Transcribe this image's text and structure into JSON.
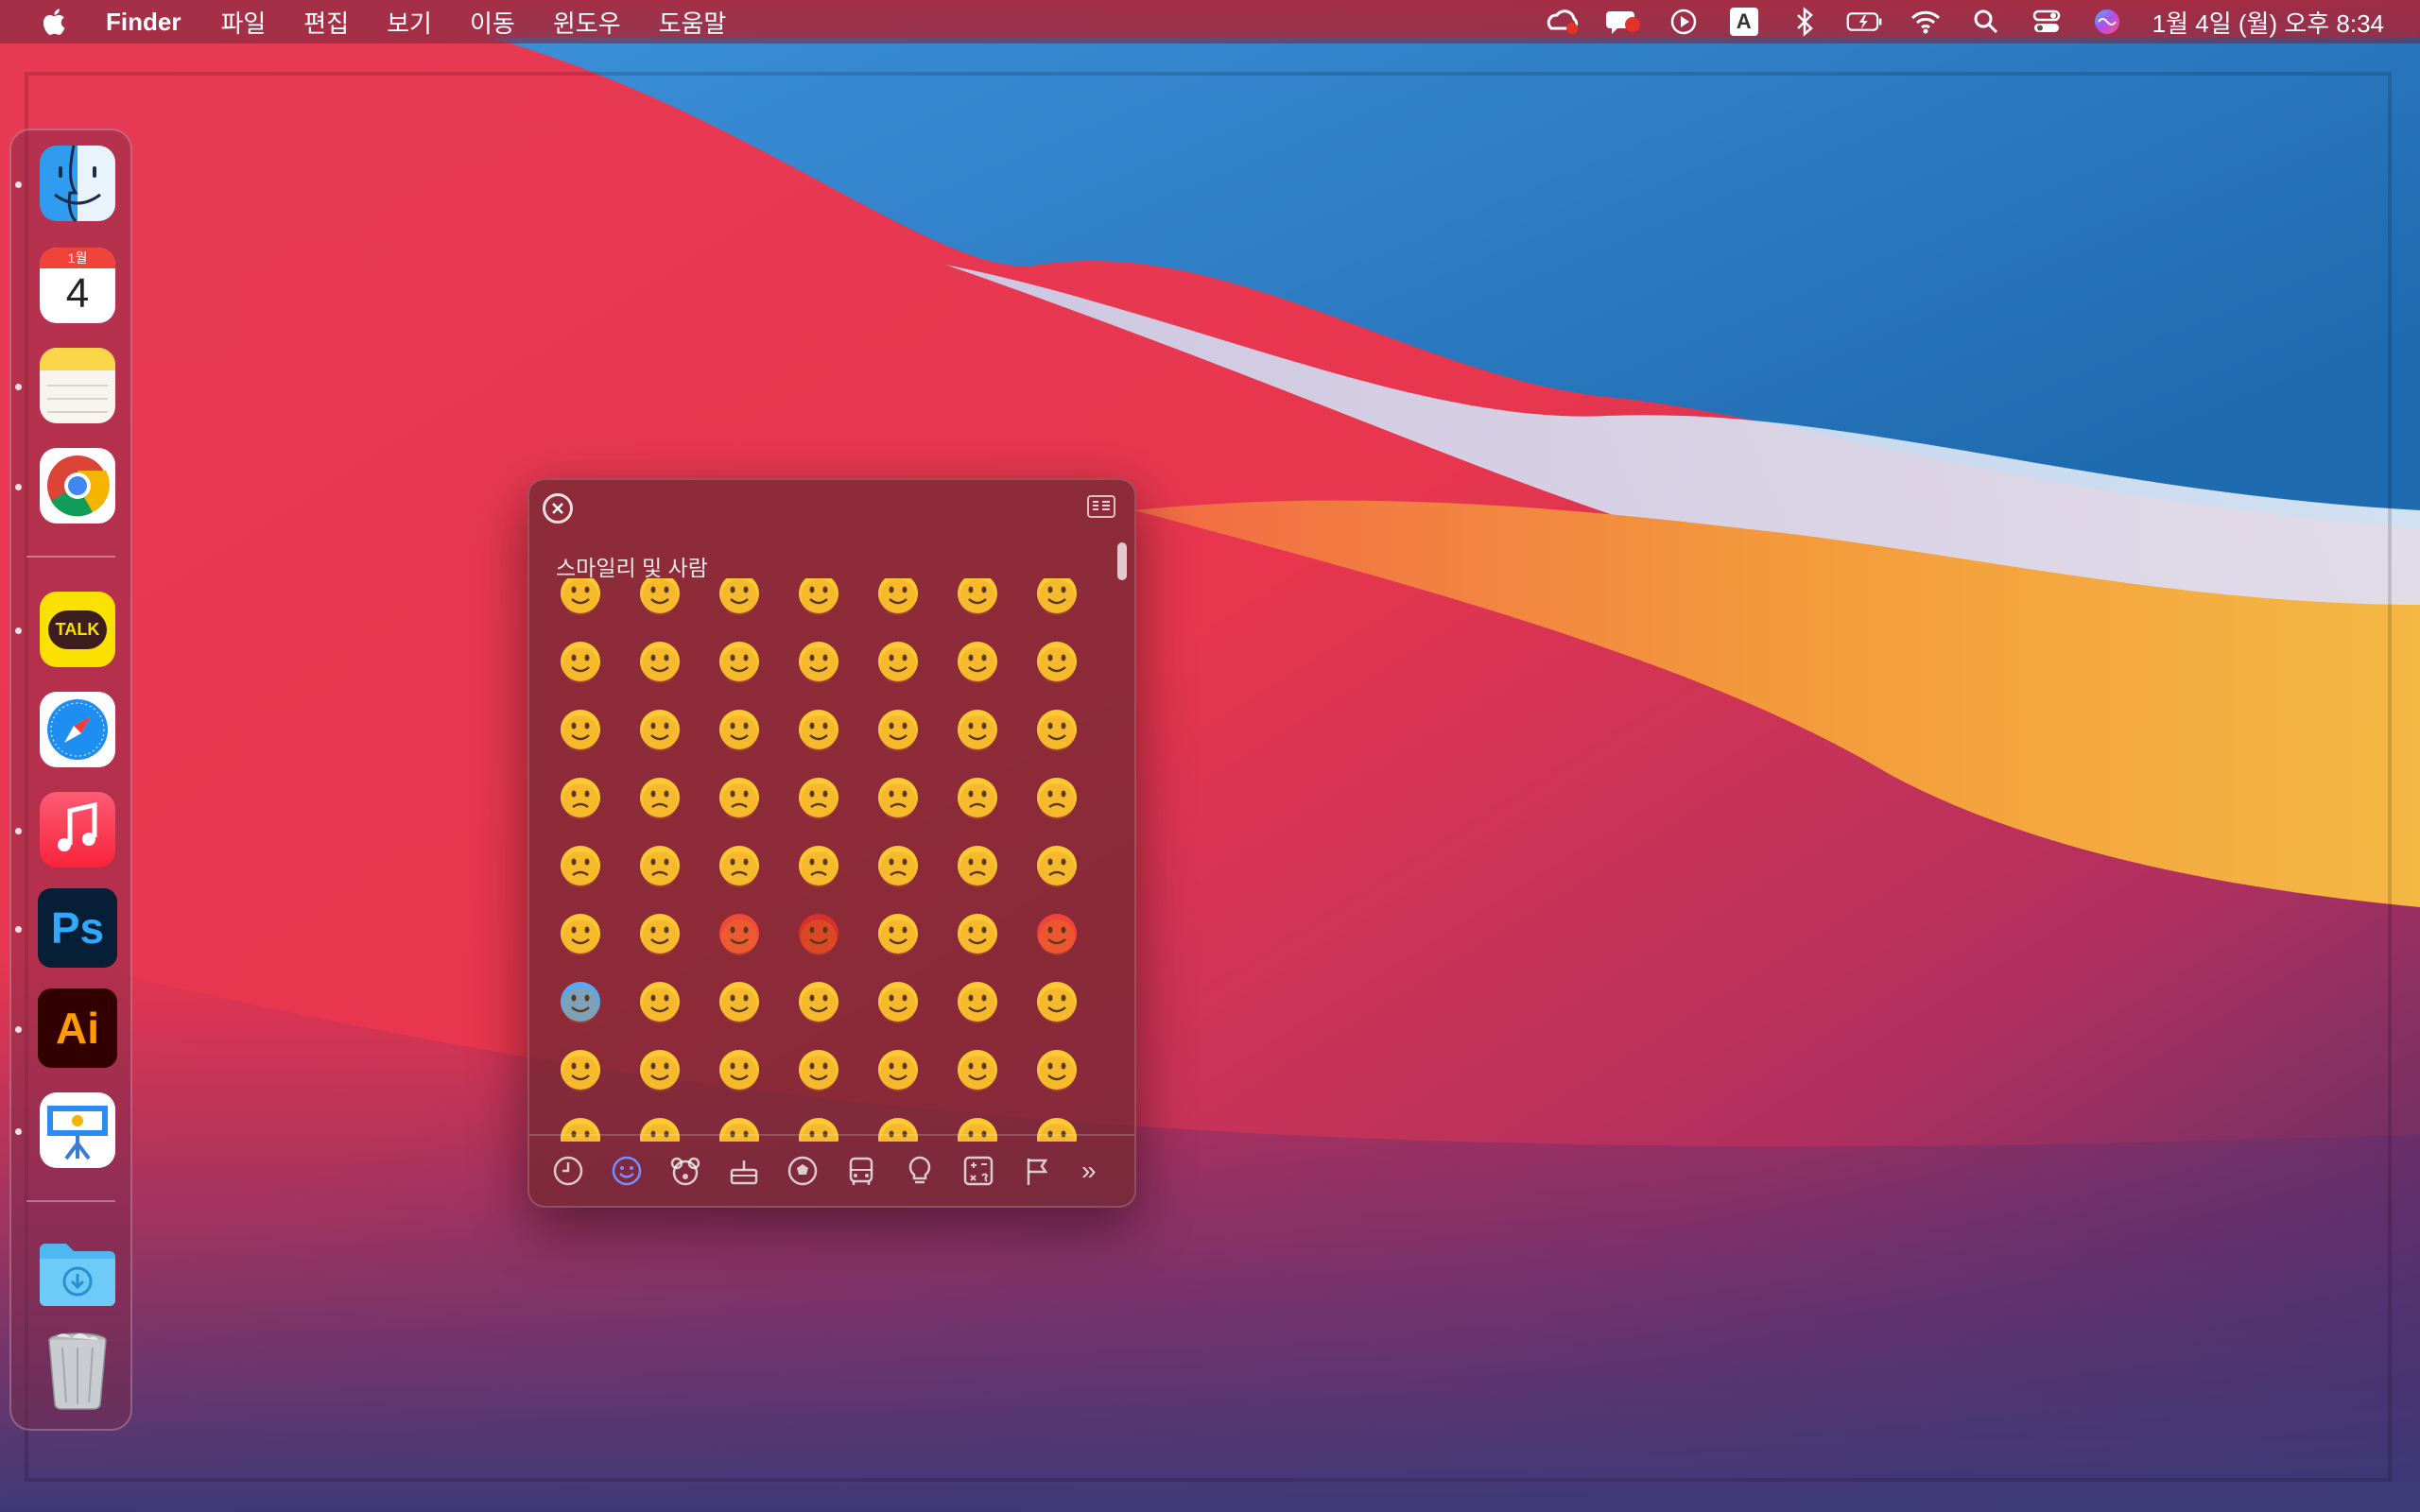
{
  "menubar": {
    "apple_icon": "apple-logo-icon",
    "app_name": "Finder",
    "menus": [
      "파일",
      "편집",
      "보기",
      "이동",
      "윈도우",
      "도움말"
    ],
    "status_icons": [
      "creative-cloud-icon",
      "notification-badge-icon",
      "play-icon",
      "input-source-A-icon",
      "bluetooth-icon",
      "battery-charging-icon",
      "wifi-icon",
      "spotlight-search-icon",
      "control-center-icon",
      "siri-icon"
    ],
    "input_source_label": "A",
    "clock": "1월 4일 (월) 오후 8:34"
  },
  "dock": {
    "items": [
      {
        "name": "finder",
        "icon": "finder-icon"
      },
      {
        "name": "calendar",
        "icon": "calendar-icon",
        "month": "1월",
        "day": "4"
      },
      {
        "name": "notes",
        "icon": "notes-icon"
      },
      {
        "name": "chrome",
        "icon": "chrome-icon"
      },
      {
        "name": "kakaotalk",
        "icon": "kakaotalk-icon",
        "label": "TALK"
      },
      {
        "name": "safari",
        "icon": "safari-icon"
      },
      {
        "name": "music",
        "icon": "music-icon"
      },
      {
        "name": "photoshop",
        "icon": "photoshop-icon",
        "label": "Ps"
      },
      {
        "name": "illustrator",
        "icon": "illustrator-icon",
        "label": "Ai"
      },
      {
        "name": "keynote",
        "icon": "keynote-icon"
      },
      {
        "name": "downloads",
        "icon": "downloads-folder-icon"
      },
      {
        "name": "trash",
        "icon": "trash-icon"
      }
    ]
  },
  "emoji_picker": {
    "section_title": "스마일리 및 사람",
    "rows": [
      [
        "😉",
        "😌",
        "😍",
        "🥰",
        "😘",
        "😗",
        "😙"
      ],
      [
        "😚",
        "😋",
        "😛",
        "😝",
        "😜",
        "🤪",
        "🤨"
      ],
      [
        "🧐",
        "🤓",
        "😎",
        "🥸",
        "🤩",
        "🥳",
        "😏"
      ],
      [
        "😒",
        "😞",
        "😔",
        "😟",
        "😕",
        "🙁",
        "☹️"
      ],
      [
        "😣",
        "😖",
        "😫",
        "😩",
        "🥺",
        "😢",
        "😭"
      ],
      [
        "😤",
        "😠",
        "😡",
        "🤬",
        "🤯",
        "😳",
        "🥵"
      ],
      [
        "🥶",
        "😱",
        "😨",
        "😰",
        "😥",
        "😓",
        "🤗"
      ],
      [
        "🤔",
        "🤭",
        "🤫",
        "🤥",
        "😶",
        "😐",
        "😑"
      ],
      [
        "😬",
        "🙄",
        "😯",
        "😦",
        "😧",
        "😮",
        "😲"
      ]
    ],
    "categories": [
      {
        "name": "recent",
        "icon": "clock-icon"
      },
      {
        "name": "smileys",
        "icon": "smiley-icon"
      },
      {
        "name": "animals",
        "icon": "bear-icon"
      },
      {
        "name": "food",
        "icon": "cake-icon"
      },
      {
        "name": "activity",
        "icon": "soccer-ball-icon"
      },
      {
        "name": "travel",
        "icon": "bus-icon"
      },
      {
        "name": "objects",
        "icon": "lightbulb-icon"
      },
      {
        "name": "symbols",
        "icon": "symbols-icon"
      },
      {
        "name": "flags",
        "icon": "flag-icon"
      }
    ],
    "more_label": "»",
    "selected_category": "smileys"
  }
}
